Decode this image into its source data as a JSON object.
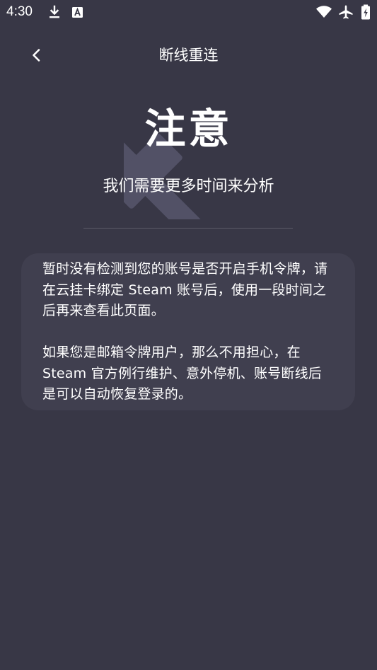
{
  "status_bar": {
    "time": "4:30",
    "icons": [
      "download-icon",
      "text-a-icon",
      "wifi-icon",
      "airplane-icon",
      "battery-icon"
    ]
  },
  "header": {
    "back_icon": "chevron-left-icon",
    "title": "断线重连"
  },
  "hero": {
    "title": "注意",
    "subtitle": "我们需要更多时间来分析",
    "watermark_icon": "broken-link-icon"
  },
  "notice": {
    "paragraphs": [
      "暂时没有检测到您的账号是否开启手机令牌，请在云挂卡绑定 Steam 账号后，使用一段时间之后再来查看此页面。",
      "如果您是邮箱令牌用户，那么不用担心，在 Steam 官方例行维护、意外停机、账号断线后是可以自动恢复登录的。"
    ]
  },
  "colors": {
    "background": "#383746",
    "card": "#403f4f",
    "divider": "#5b5a68",
    "watermark": "#55546a",
    "text": "#ffffff"
  }
}
